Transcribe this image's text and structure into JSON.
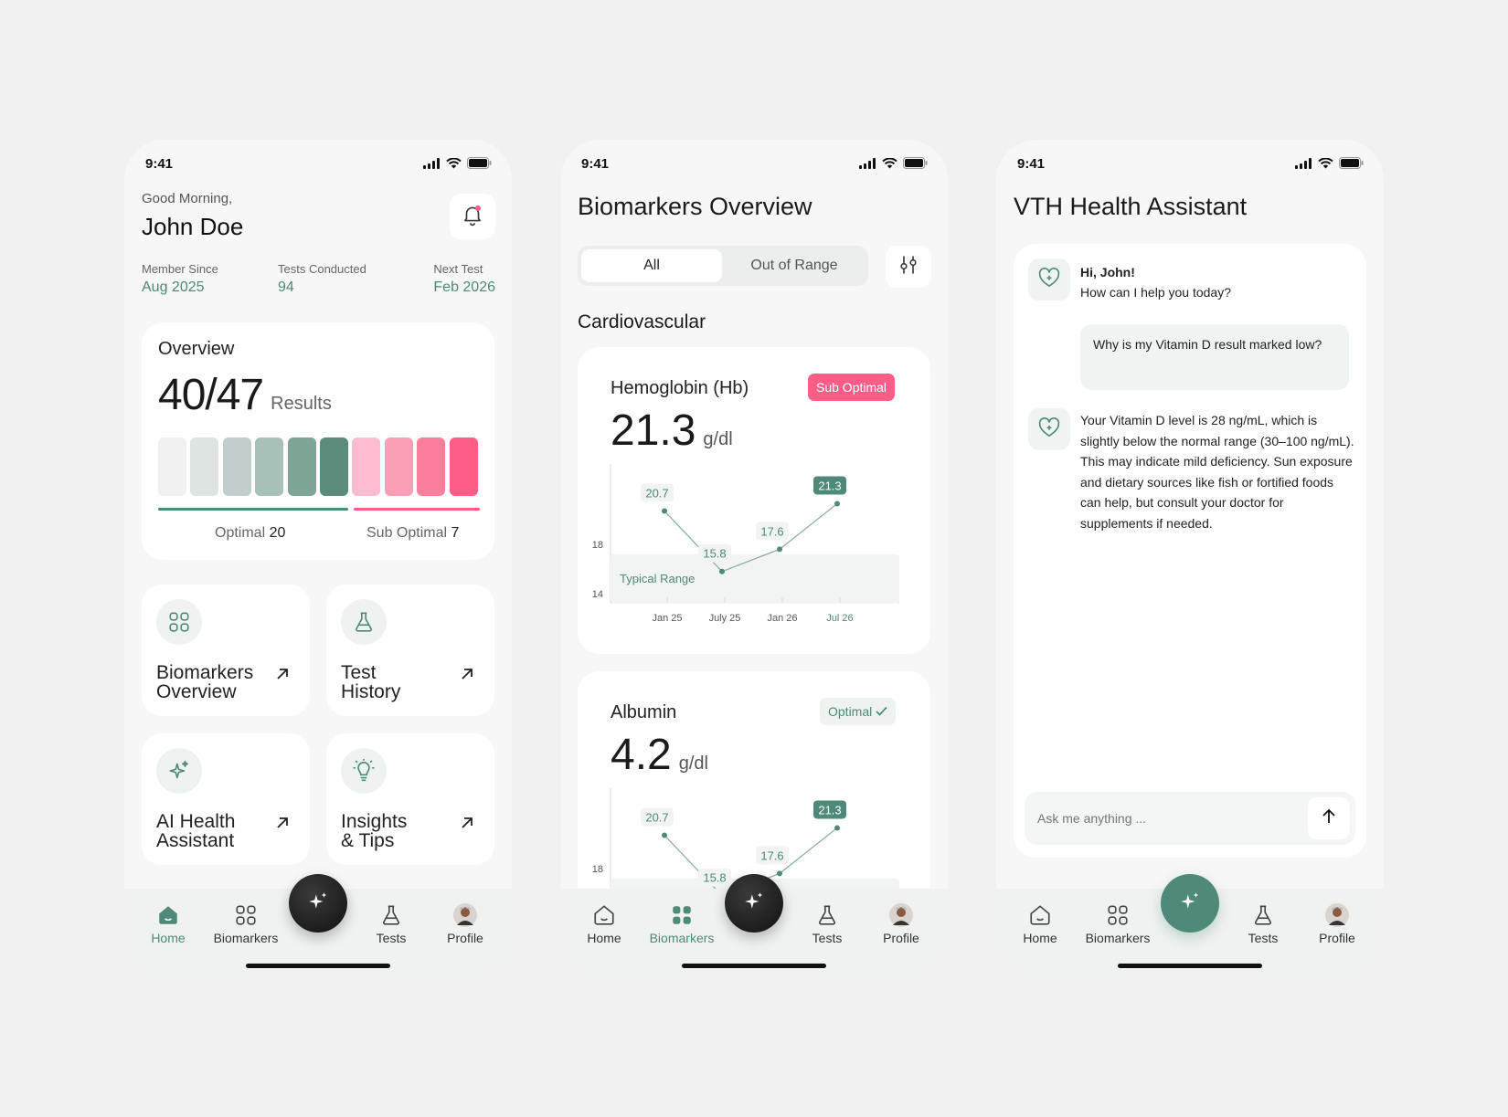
{
  "screen1": {
    "time": "9:41",
    "greeting": "Good Morning,",
    "name": "John Doe",
    "stats": [
      {
        "label": "Member Since",
        "value": "Aug 2025"
      },
      {
        "label": "Tests Conducted",
        "value": "94"
      },
      {
        "label": "Next Test",
        "value": "Feb 2026"
      }
    ],
    "overview": {
      "title": "Overview",
      "count": "40/47",
      "count_suffix": "Results",
      "optimal_label": "Optimal",
      "optimal_value": "20",
      "suboptimal_label": "Sub Optimal",
      "suboptimal_value": "7",
      "bar_colors": [
        "#f0f1f0",
        "#dee4e2",
        "#c2cecb",
        "#a7c1b8",
        "#7fa597",
        "#5b8c7b",
        "#fdbccf",
        "#fb9fb6",
        "#fb7f9d",
        "#fd5d86"
      ]
    },
    "tiles": [
      {
        "label1": "Biomarkers",
        "label2": "Overview",
        "icon": "grid-icon"
      },
      {
        "label1": "Test",
        "label2": "History",
        "icon": "flask-icon"
      },
      {
        "label1": "AI Health",
        "label2": "Assistant",
        "icon": "sparkle-icon"
      },
      {
        "label1": "Insights",
        "label2": "& Tips",
        "icon": "lightbulb-icon"
      }
    ]
  },
  "screen2": {
    "time": "9:41",
    "title": "Biomarkers Overview",
    "tab_all": "All",
    "tab_out": "Out of Range",
    "section": "Cardiovascular",
    "markers": [
      {
        "name": "Hemoglobin (Hb)",
        "value": "21.3",
        "unit": "g/dl",
        "badge": "Sub Optimal"
      },
      {
        "name": "Albumin",
        "value": "4.2",
        "unit": "g/dl",
        "badge": "Optimal"
      }
    ],
    "range_label": "Typical Range",
    "x_ticks": [
      "Jan 25",
      "July 25",
      "Jan 26",
      "Jul 26"
    ],
    "y_ticks": [
      "18",
      "14"
    ],
    "points": [
      "20.7",
      "15.8",
      "17.6",
      "21.3"
    ]
  },
  "screen3": {
    "time": "9:41",
    "title": "VTH Health Assistant",
    "bot_greeting_1": "Hi, John!",
    "bot_greeting_2": "How can I help you today?",
    "user_msg": "Why is my Vitamin D result marked low?",
    "bot_reply": "Your Vitamin D level is 28 ng/mL, which is slightly below the normal range (30–100 ng/mL). This may indicate mild deficiency. Sun exposure and dietary sources like fish or fortified foods can help, but consult your doctor for supplements if needed.",
    "input_placeholder": "Ask me anything ..."
  },
  "nav": {
    "home": "Home",
    "biomarkers": "Biomarkers",
    "tests": "Tests",
    "profile": "Profile"
  },
  "colors": {
    "accent": "#4e8a77",
    "pink": "#fd5d86",
    "bg": "#f6f7f6"
  }
}
